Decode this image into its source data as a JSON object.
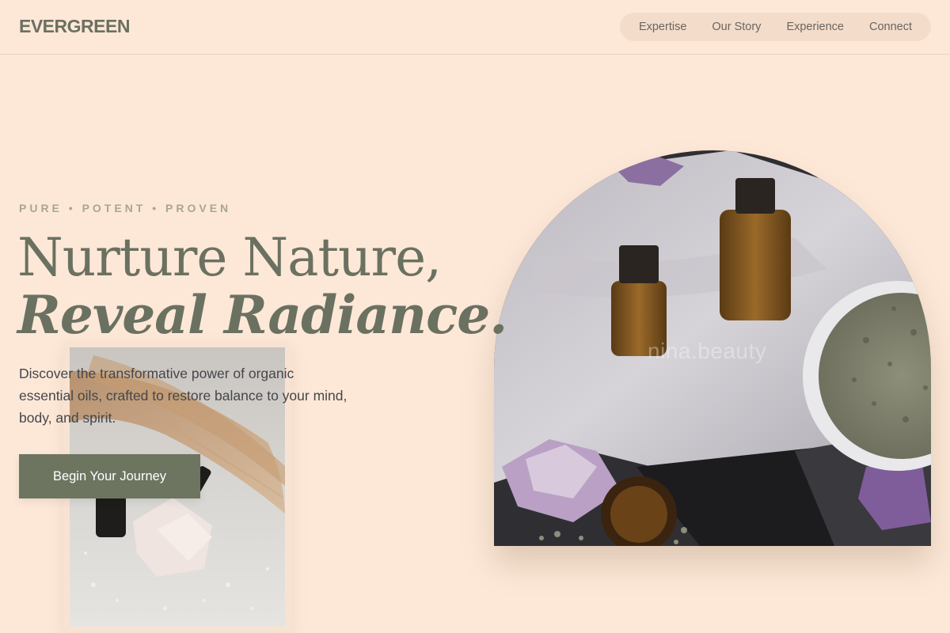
{
  "brand": {
    "logo": "EVERGREEN"
  },
  "nav": {
    "items": [
      {
        "label": "Expertise"
      },
      {
        "label": "Our Story"
      },
      {
        "label": "Experience"
      },
      {
        "label": "Connect"
      }
    ]
  },
  "hero": {
    "eyebrow": "PURE • POTENT • PROVEN",
    "headline_line1": "Nurture Nature,",
    "headline_line2": "Reveal Radiance.",
    "description": "Discover the transformative power of organic essential oils, crafted to restore balance to your mind, body, and spirit.",
    "cta_label": "Begin Your Journey"
  },
  "media": {
    "arch_watermark": "nina.beauty",
    "arch_image": "essential-oil-bottles-lavender-crystals-photo",
    "card_image": "dropper-bottle-crystal-pampas-grass-photo"
  },
  "colors": {
    "background": "#fde8d8",
    "accent": "#6d7561",
    "nav_pill": "#f3dcca",
    "headline": "#6b7160",
    "eyebrow": "#a8a594"
  }
}
